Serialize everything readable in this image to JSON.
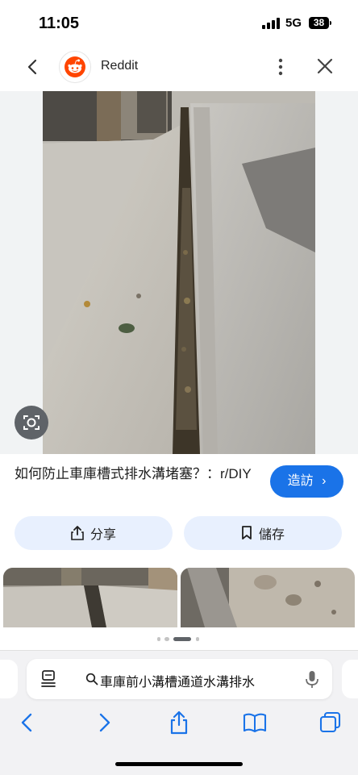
{
  "status_bar": {
    "time": "11:05",
    "network": "5G",
    "battery": "38"
  },
  "header": {
    "site_name": "Reddit",
    "back_icon": "chevron-left-icon",
    "more_icon": "more-vert-icon",
    "close_icon": "close-icon"
  },
  "result": {
    "title": "如何防止車庫槽式排水溝堵塞？：r/DIY",
    "visit_label": "造訪",
    "share_label": "分享",
    "save_label": "儲存"
  },
  "carousel": {
    "current_index": 2,
    "total": 4
  },
  "browser": {
    "search_query": "車庫前小溝槽通道水溝排水"
  },
  "colors": {
    "accent": "#1a73e8",
    "pill_bg": "#e8f0fe",
    "reddit_orange": "#ff4500"
  }
}
